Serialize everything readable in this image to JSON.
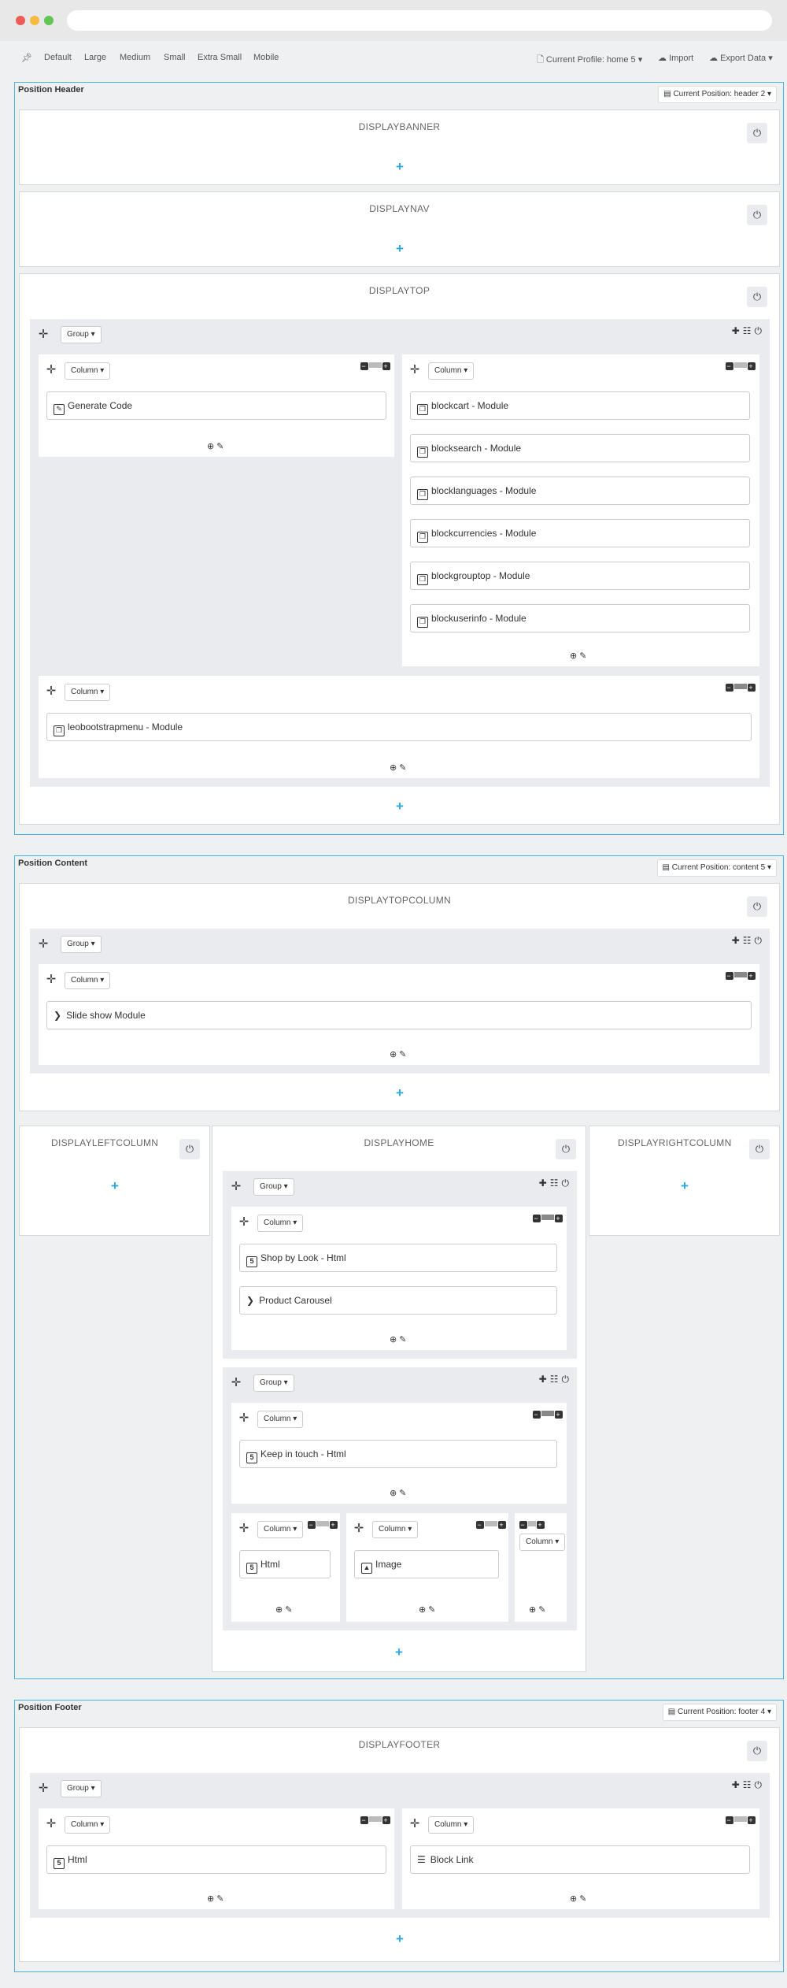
{
  "toolbar": {
    "devices": [
      "Default",
      "Large",
      "Medium",
      "Small",
      "Extra Small",
      "Mobile"
    ],
    "profile": "Current Profile: home 5",
    "import": "Import",
    "export": "Export Data"
  },
  "header": {
    "title": "Position Header",
    "current": "Current Position: header 2",
    "hooks": {
      "banner": "DISPLAYBANNER",
      "nav": "DISPLAYNAV",
      "top": "DISPLAYTOP"
    }
  },
  "content": {
    "title": "Position Content",
    "current": "Current Position: content 5",
    "hooks": {
      "topcolumn": "DISPLAYTOPCOLUMN",
      "left": "DISPLAYLEFTCOLUMN",
      "home": "DISPLAYHOME",
      "right": "DISPLAYRIGHTCOLUMN"
    }
  },
  "footer": {
    "title": "Position Footer",
    "current": "Current Position: footer 4",
    "hooks": {
      "footer": "DISPLAYFOOTER"
    }
  },
  "labels": {
    "group": "Group",
    "column": "Column"
  },
  "modules": {
    "generate_code": "Generate Code",
    "blockcart": "blockcart - Module",
    "blocksearch": "blocksearch - Module",
    "blocklanguages": "blocklanguages - Module",
    "blockcurrencies": "blockcurrencies - Module",
    "blockgrouptop": "blockgrouptop - Module",
    "blockuserinfo": "blockuserinfo - Module",
    "leobootstrapmenu": "leobootstrapmenu - Module",
    "slideshow": "Slide show Module",
    "shopbylook": "Shop by Look - Html",
    "productcarousel": "Product Carousel",
    "keepintouch": "Keep in touch - Html",
    "html": "Html",
    "image": "Image",
    "footer_html": "Html",
    "blocklink": "Block Link"
  }
}
